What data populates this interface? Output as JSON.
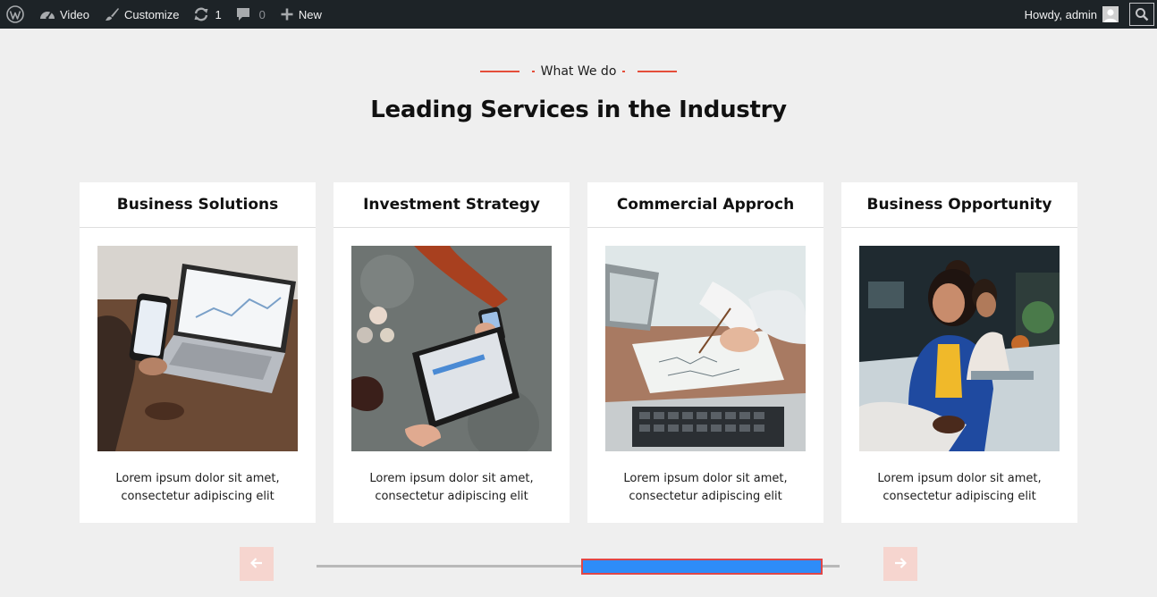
{
  "adminbar": {
    "items": [
      {
        "icon": "wordpress-logo-icon"
      },
      {
        "icon": "dashboard-icon",
        "label": "Video"
      },
      {
        "icon": "paintbrush-icon",
        "label": "Customize"
      },
      {
        "icon": "updates-icon",
        "count": "1"
      },
      {
        "icon": "comment-icon",
        "count": "0"
      },
      {
        "icon": "plus-icon",
        "label": "New"
      }
    ],
    "greeting": "Howdy, admin",
    "search_icon": "search-icon"
  },
  "section": {
    "eyebrow": "What We do",
    "title": "Leading Services in the Industry",
    "accent_color": "#e44d3a"
  },
  "cards": [
    {
      "title": "Business Solutions",
      "text_line1": "Lorem ipsum dolor sit amet,",
      "text_line2": "consectetur adipiscing elit"
    },
    {
      "title": "Investment Strategy",
      "text_line1": "Lorem ipsum dolor sit amet,",
      "text_line2": "consectetur adipiscing elit"
    },
    {
      "title": "Commercial Approch",
      "text_line1": "Lorem ipsum dolor sit amet,",
      "text_line2": "consectetur adipiscing elit"
    },
    {
      "title": "Business Opportunity",
      "text_line1": "Lorem ipsum dolor sit amet,",
      "text_line2": "consectetur adipiscing elit"
    }
  ],
  "slider": {
    "prev_icon": "arrow-left-icon",
    "next_icon": "arrow-right-icon",
    "thumb_color": "#2e8cf8",
    "arrow_bg": "#f6d5cf"
  }
}
